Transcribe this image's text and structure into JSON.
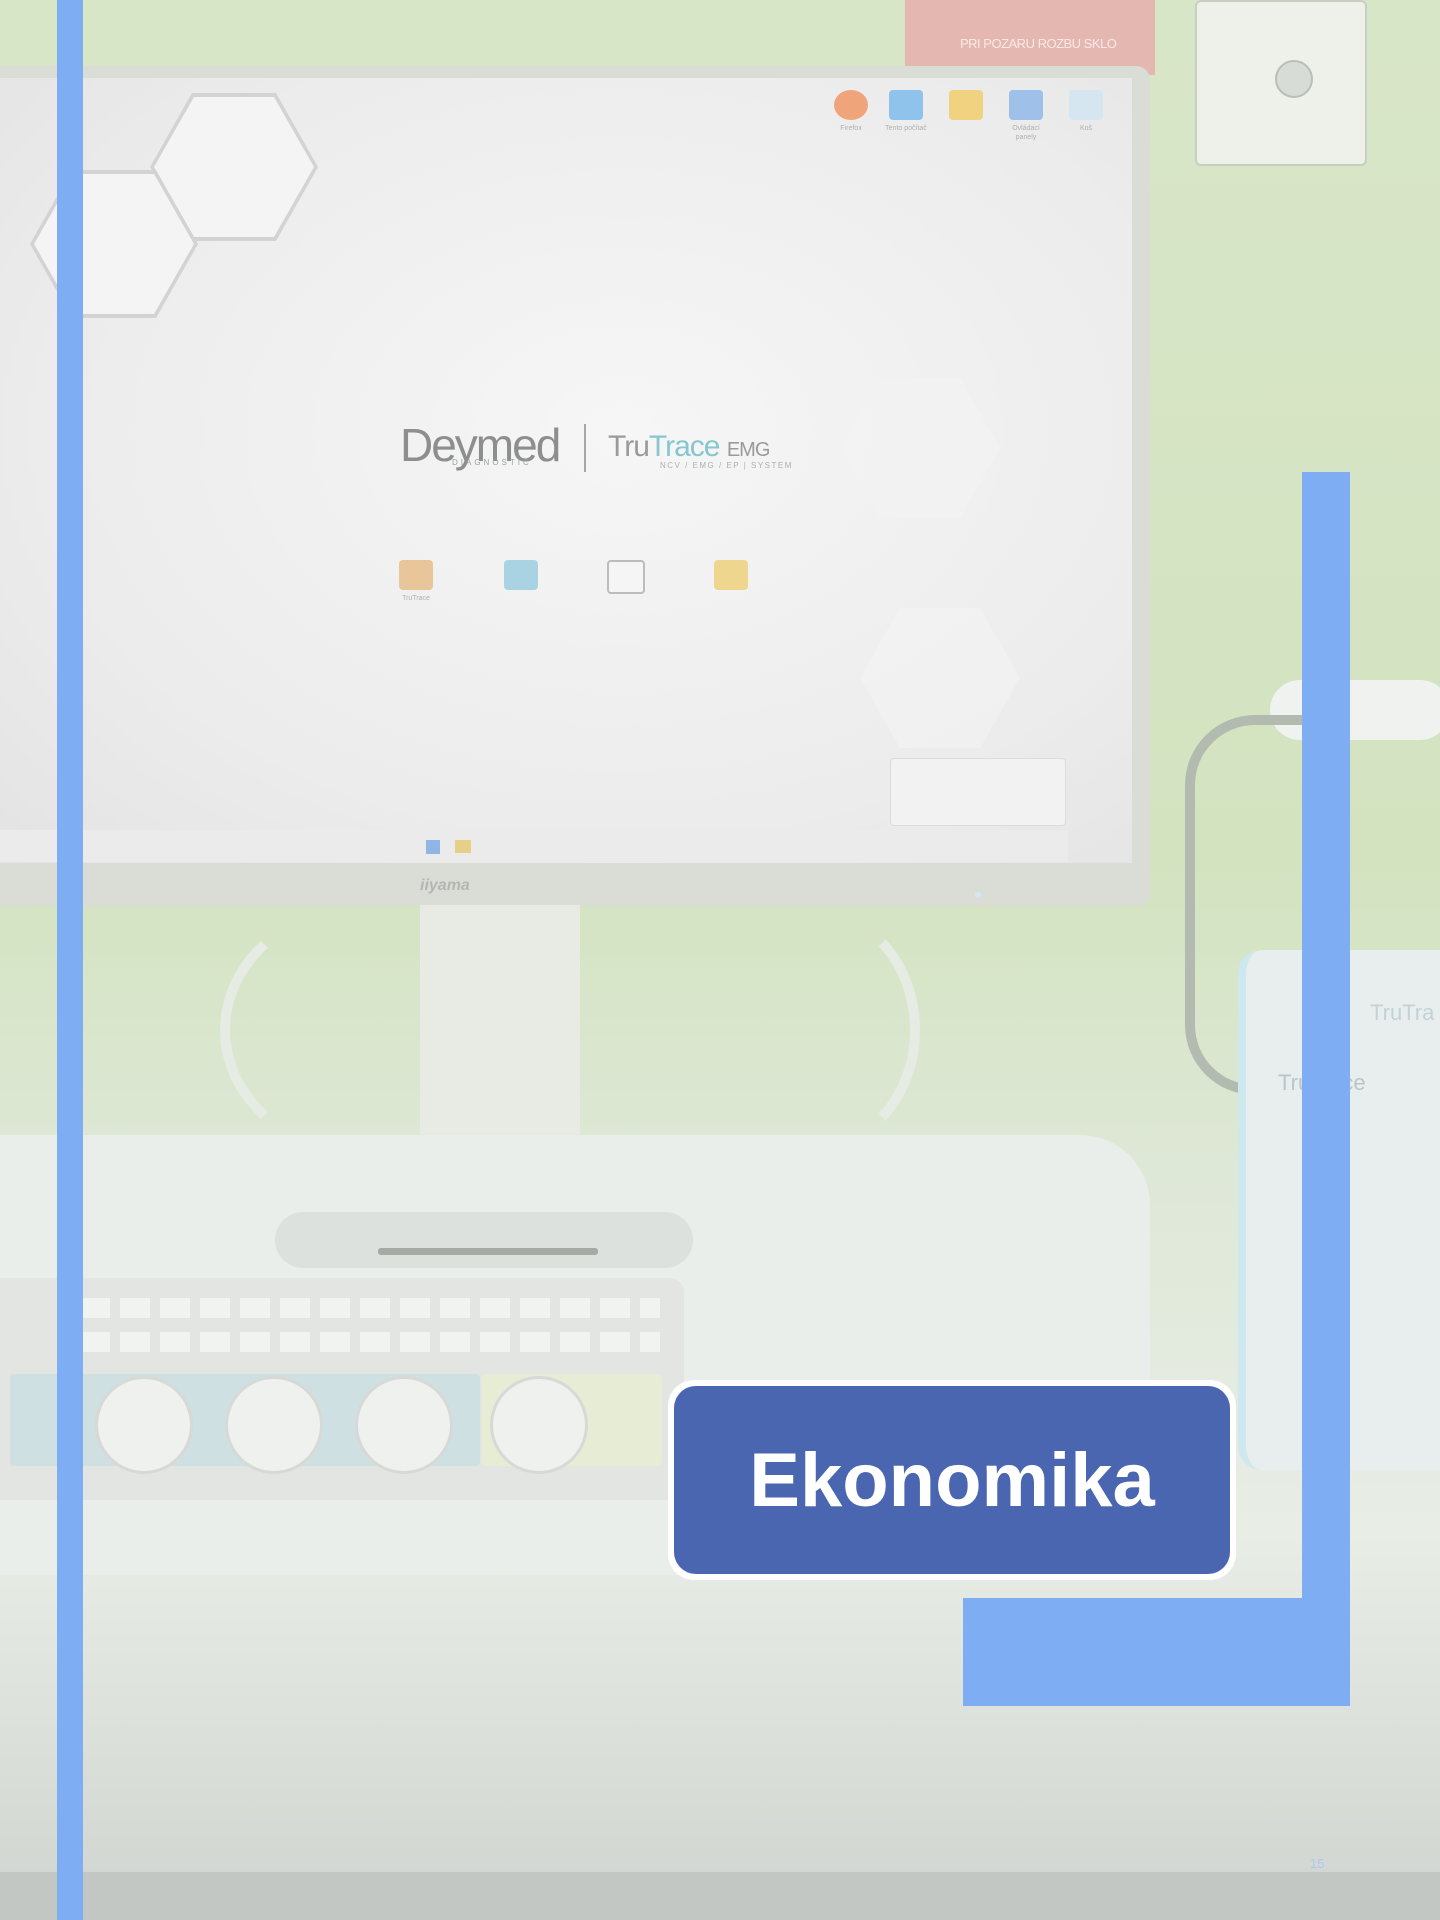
{
  "photo": {
    "wall_sign": "PRI POZARU ROZBU SKLO",
    "brand": "Deymed",
    "brand_sub": "DIAGNOSTIC",
    "product_tru": "Tru",
    "product_trace": "Trace",
    "product_emg": "EMG",
    "product_sub": "NCV / EMG / EP | SYSTEM",
    "monitor_logo": "iiyama",
    "device_label": "TruTra",
    "device_label2": "TruTrace",
    "top_icons": [
      "Firefox",
      "Tento počítač",
      "",
      "Ovládací panely",
      "Koš"
    ],
    "center_icons": [
      "TruTrace",
      "",
      "",
      ""
    ],
    "colors": {
      "accent_blue": "#7fadf3",
      "title_fill": "#4a66b0"
    }
  },
  "document": {
    "title": "Ekonomika",
    "page_number": "15"
  }
}
